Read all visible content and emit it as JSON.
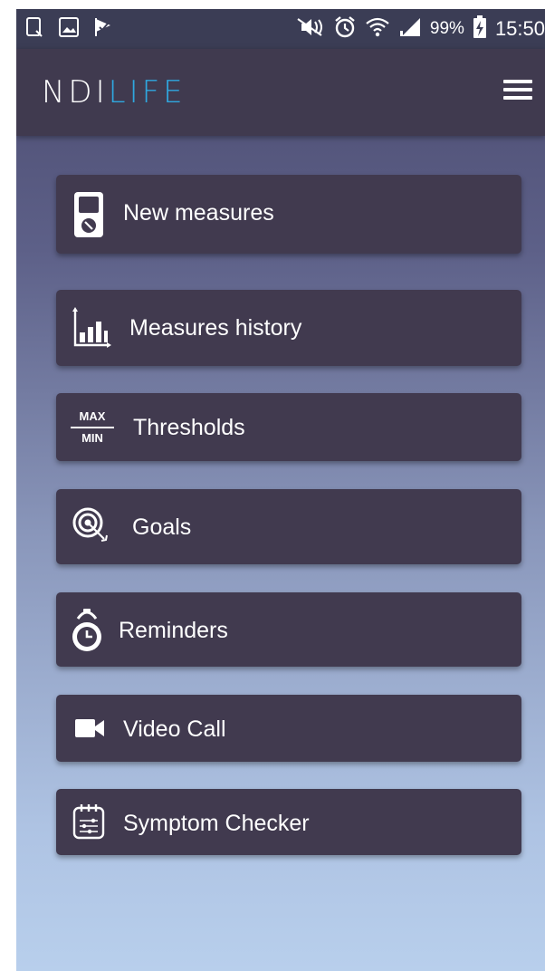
{
  "status_bar": {
    "battery_percent": "99%",
    "time": "15:50",
    "left_icons": [
      "notification-tablet-icon",
      "image-icon",
      "flag-check-icon"
    ],
    "right_icons": [
      "mute-icon",
      "alarm-icon",
      "wifi-icon",
      "signal-icon",
      "battery-charging-icon"
    ]
  },
  "app": {
    "logo_nd": "NDI",
    "logo_life": "LIFE",
    "menu_icon": "hamburger-menu-icon"
  },
  "menu": {
    "items": [
      {
        "label": "New measures",
        "icon": "measuring-device-icon"
      },
      {
        "label": "Measures history",
        "icon": "bar-chart-icon"
      },
      {
        "label": "Thresholds",
        "icon": "max-min-icon",
        "icon_text_top": "MAX",
        "icon_text_bottom": "MIN"
      },
      {
        "label": "Goals",
        "icon": "target-icon"
      },
      {
        "label": "Reminders",
        "icon": "alarm-clock-icon"
      },
      {
        "label": "Video Call",
        "icon": "video-camera-icon"
      },
      {
        "label": "Symptom Checker",
        "icon": "calendar-checklist-icon"
      }
    ]
  },
  "colors": {
    "status_bar": "#3b3d55",
    "app_bar": "#403a4f",
    "menu_item": "#413a4f",
    "logo_accent": "#2fa8e0",
    "bg_top": "#4a4a6e",
    "bg_bottom": "#b8cfec"
  }
}
